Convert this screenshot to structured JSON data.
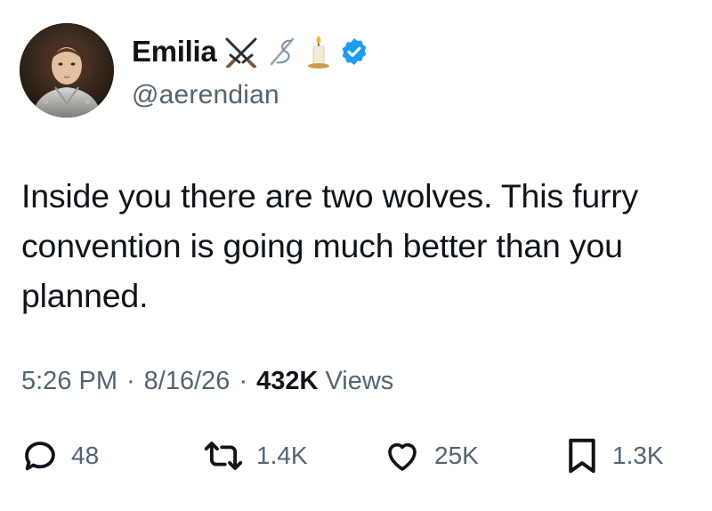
{
  "author": {
    "display_name": "Emilia",
    "handle": "@aerendian",
    "name_emojis": [
      "crossed-swords-icon",
      "needle-thread-icon",
      "candle-icon"
    ],
    "verified": true,
    "verified_color": "#1d9bf0"
  },
  "tweet": {
    "lines": [
      "Inside you there are two wolves. This furry",
      "convention is going much better than you",
      "planned."
    ]
  },
  "meta": {
    "time": "5:26 PM",
    "separator": "·",
    "date": "8/16/26",
    "views_count": "432K",
    "views_label": "Views"
  },
  "actions": {
    "replies": "48",
    "reposts": "1.4K",
    "likes": "25K",
    "bookmarks": "1.3K"
  },
  "colors": {
    "text_primary": "#0f1419",
    "text_secondary": "#536471",
    "background": "#ffffff"
  }
}
